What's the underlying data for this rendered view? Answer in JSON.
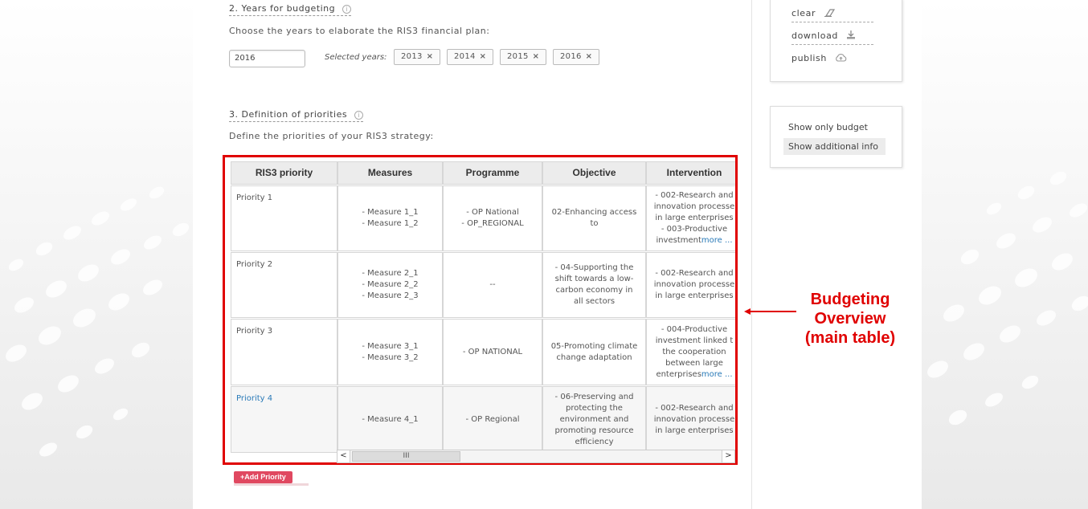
{
  "sections": {
    "years": {
      "title": "2. Years for budgeting",
      "description": "Choose the years to elaborate the RIS3 financial plan:",
      "input_value": "2016",
      "selected_label": "Selected years:",
      "selected_years": [
        "2013",
        "2014",
        "2015",
        "2016"
      ],
      "remove_glyph": "×"
    },
    "priorities": {
      "title": "3. Definition of priorities",
      "description": "Define the priorities of your RIS3 strategy:"
    }
  },
  "actions": {
    "clear": "clear",
    "download": "download",
    "publish": "publish"
  },
  "view_options": {
    "budget_only": "Show only budget",
    "additional_info": "Show additional info"
  },
  "table": {
    "headers": [
      "RIS3 priority",
      "Measures",
      "Programme",
      "Objective",
      "Intervention"
    ],
    "rows": [
      {
        "priority": "Priority 1",
        "measures": "- Measure 1_1\n- Measure 1_2",
        "programme": "- OP National\n- OP_REGIONAL",
        "objective": "02-Enhancing access\nto",
        "intervention": "- 002-Research and\ninnovation processe\nin large enterprises\n- 003-Productive\ninvestment",
        "more": "more ..."
      },
      {
        "priority": "Priority 2",
        "measures": "- Measure 2_1\n- Measure 2_2\n- Measure 2_3",
        "programme": "--",
        "objective": "- 04-Supporting the\nshift towards a low-\ncarbon economy in\nall sectors",
        "intervention": "- 002-Research and\ninnovation processe\nin large enterprises",
        "more": ""
      },
      {
        "priority": "Priority 3",
        "measures": "- Measure 3_1\n- Measure 3_2",
        "programme": "- OP NATIONAL",
        "objective": "05-Promoting climate\nchange adaptation",
        "intervention": "- 004-Productive\ninvestment linked t\nthe cooperation\nbetween large\nenterprises",
        "more": "more ..."
      },
      {
        "priority": "Priority 4",
        "measures": "- Measure 4_1",
        "programme": "- OP Regional",
        "objective": "- 06-Preserving and\nprotecting the\nenvironment and\npromoting resource\nefficiency",
        "intervention": "- 002-Research and\ninnovation processe\nin large enterprises",
        "more": ""
      }
    ]
  },
  "scrollbar": {
    "left_glyph": "<",
    "right_glyph": ">",
    "thumb_glyph": "III"
  },
  "add_priority_label": "+Add Priority",
  "annotation": {
    "line1": "Budgeting",
    "line2": "Overview",
    "line3": "(main table)",
    "color": "#e00000"
  },
  "icons": {
    "info": "info-icon",
    "clear": "eraser-icon",
    "download": "download-icon",
    "publish": "cloud-upload-icon"
  }
}
